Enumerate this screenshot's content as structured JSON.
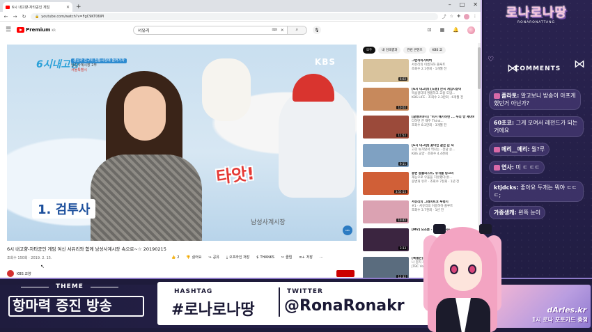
{
  "browser": {
    "tab_title": "6시 내고향-자타공인 게임",
    "url": "youtube.com/watch?v=FgC9KT06lPI",
    "window_controls": [
      "–",
      "□",
      "✕"
    ]
  },
  "youtube": {
    "logo_text": "Premium",
    "logo_region": "KR",
    "search_value": "서유리",
    "chips": [
      "모두",
      "내 검색결과",
      "관련 콘텐츠",
      "KBS 교"
    ]
  },
  "video": {
    "show_logo": "6시내고향",
    "overlay_line1": "경남과 친구되 전통시장에 놀러가자",
    "overlay_line2": "남성사계시장 2부",
    "overlay_line3": "서울특별시",
    "broadcaster": "KBS",
    "caption_main": "1. 검투사",
    "sfx_text": "타앗!",
    "sign_text": "남성사계시장",
    "title": "6시 내고향-자타공인 게임 여신 서유리와 함께 남성사계시장 속으로~☆ 20190215",
    "meta": "조회수 150회 · 2019. 2. 15.",
    "channel": "KBS 교양",
    "actions": [
      {
        "icon": "like-icon",
        "label": "2"
      },
      {
        "icon": "dislike-icon",
        "label": "싫어요"
      },
      {
        "icon": "share-icon",
        "label": "공유"
      },
      {
        "icon": "offline-icon",
        "label": "오프라인 저장"
      },
      {
        "icon": "thanks-icon",
        "label": "THANKS"
      },
      {
        "icon": "clip-icon",
        "label": "클립"
      },
      {
        "icon": "save-icon",
        "label": "저장"
      }
    ]
  },
  "recommendations": [
    {
      "title": "그런하하거비버",
      "channel": "서유리의 이름하하 플루트",
      "meta": "조회수 2.1천회 · 1개월 전",
      "duration": "6:02",
      "color": "#d9c39c"
    },
    {
      "title": "[6시 내고향] [도봉] 한국 게임시장이",
      "channel": "목숨걸다데 명품하고 고용 도압...",
      "meta": "KBS LIFE · 조회수 2.3만회 · 6개월 전",
      "duration": "10:02",
      "color": "#c7895c"
    },
    {
      "title": "[글렝이야기] \"이거 얘기하면 ... 우리 방 세어봐",
      "channel": "디하면 한 재주 Think...",
      "meta": "조회수 8.2만회 · 3개월 전",
      "duration": "11:52",
      "color": "#9b4a3a"
    },
    {
      "title": "[6시 내고향] 꽃미인 같은 순 숙",
      "channel": "고깃 뉴가탔서 역나는 · 전남 순...",
      "meta": "KBS 교양 · 조회수 4.4천회",
      "duration": "9:11",
      "color": "#7fa1c2"
    },
    {
      "title": "웅변 동물리스트, 유귀들 링크의",
      "channel": "재능으로 우울을 치유했다(유...",
      "meta": "웅변개 유르 · 조회수 7천회 · 1년 전",
      "duration": "3:55:55",
      "color": "#d05f37"
    },
    {
      "title": "서유리의 그레이트코 투병기",
      "channel": "#1 · 서유리의 이름하하 플루트",
      "meta": "조회수 3.7천회 · 1년 전",
      "duration": "10:42",
      "color": "#dba2b2"
    },
    {
      "title": "[MV] 요조론 - 크 Choose me",
      "channel": "",
      "meta": "",
      "duration": "3:33",
      "color": "#3b2540"
    },
    {
      "title": "[특별한] 음...",
      "channel": "나 뭔지 개",
      "meta": "JTBC Voyage",
      "duration": "12:32",
      "color": "#5a6c7e"
    }
  ],
  "panel": {
    "brand_name": "로나로나땅",
    "brand_sub": "RONARONATTANG",
    "comments_title": "COMMENTS",
    "comments": [
      {
        "user": "플라토:",
        "text": " 알고보니 방송이 아프게했던거 아닌가?"
      },
      {
        "user": "60초코:",
        "text": " 그게 모여서 레전드가 되는거에요"
      },
      {
        "user": "메리__메리:",
        "text": " 뭘?루"
      },
      {
        "user": "연사:",
        "text": " 미 ㄷ ㄷㄷ"
      },
      {
        "user": "ktjdcks:",
        "text": " 좋아요 두개는 뭐야 ㄷㄷㄷ;"
      },
      {
        "user": "가중생캐:",
        "text": " 왼쪽 눈이"
      }
    ]
  },
  "banner": {
    "theme_label": "THEME",
    "theme_text": "항마력 증진 방송",
    "hashtag_label": "HASHTAG",
    "hashtag_value": "#로나로나땅",
    "twitter_label": "TWITTER",
    "twitter_value": "@RonaRonakr",
    "card_line1": "dArles.kr",
    "card_line2": "1시 로나 포토카드 증정"
  }
}
